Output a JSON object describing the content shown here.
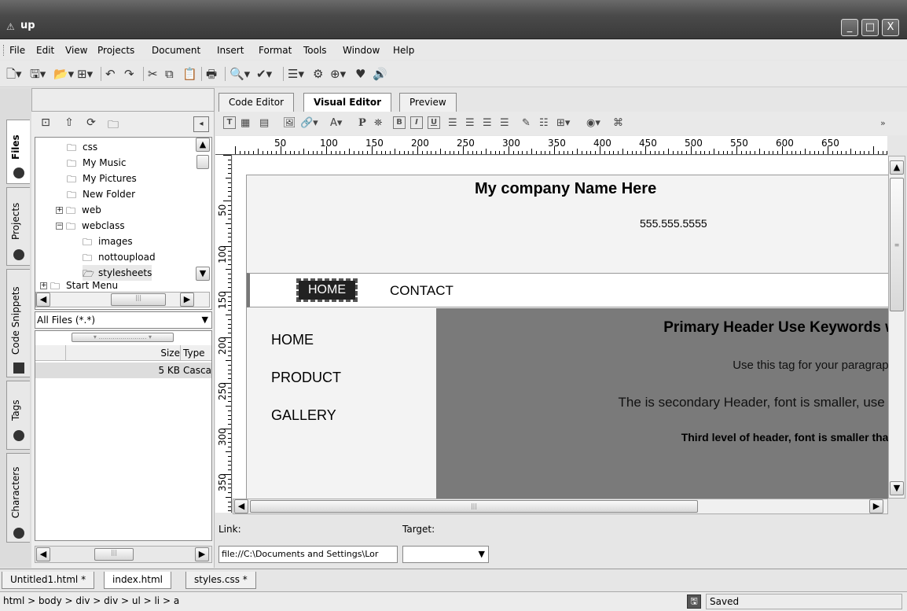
{
  "window": {
    "title": "up",
    "minimize": "_",
    "maximize": "□",
    "close": "X"
  },
  "menu": [
    "File",
    "Edit",
    "View",
    "Projects",
    "Document",
    "Insert",
    "Format",
    "Tools",
    "Window",
    "Help"
  ],
  "side_tabs": [
    "Files",
    "Projects",
    "Code Snippets",
    "Tags",
    "Characters"
  ],
  "tree": [
    "css",
    "My Music",
    "My Pictures",
    "New Folder",
    "web",
    "webclass",
    "images",
    "nottoupload",
    "stylesheets",
    "Start Menu"
  ],
  "filter": "All Files (*.*)",
  "file_columns": {
    "size": "Size",
    "type": "Type"
  },
  "file_row": {
    "size": "5 KB",
    "type": "Casca"
  },
  "editor_tabs": [
    "Code Editor",
    "Visual Editor",
    "Preview"
  ],
  "ruler_h": [
    "50",
    "100",
    "150",
    "200",
    "250",
    "300",
    "350",
    "400",
    "450",
    "500",
    "550",
    "600",
    "650"
  ],
  "ruler_v": [
    "50",
    "100",
    "150",
    "200",
    "250",
    "300",
    "350"
  ],
  "page": {
    "company": "My company Name Here",
    "phone": "555.555.5555",
    "topnav": [
      "HOME",
      "CONTACT"
    ],
    "sidenav": [
      "HOME",
      "PRODUCT",
      "GALLERY"
    ],
    "h1": "Primary Header Use Keywords w",
    "p": "Use this tag for your paragraph",
    "h2": "The is secondary Header, font is smaller, use s",
    "h3": "Third level of header, font is smaller than"
  },
  "props": {
    "link_label": "Link:",
    "target_label": "Target:",
    "link_value": "file://C:\\Documents and Settings\\Lor"
  },
  "doc_tabs": [
    "Untitled1.html *",
    "index.html",
    "styles.css *"
  ],
  "status": {
    "path": "html > body > div > div > ul > li > a",
    "saved": "Saved"
  }
}
